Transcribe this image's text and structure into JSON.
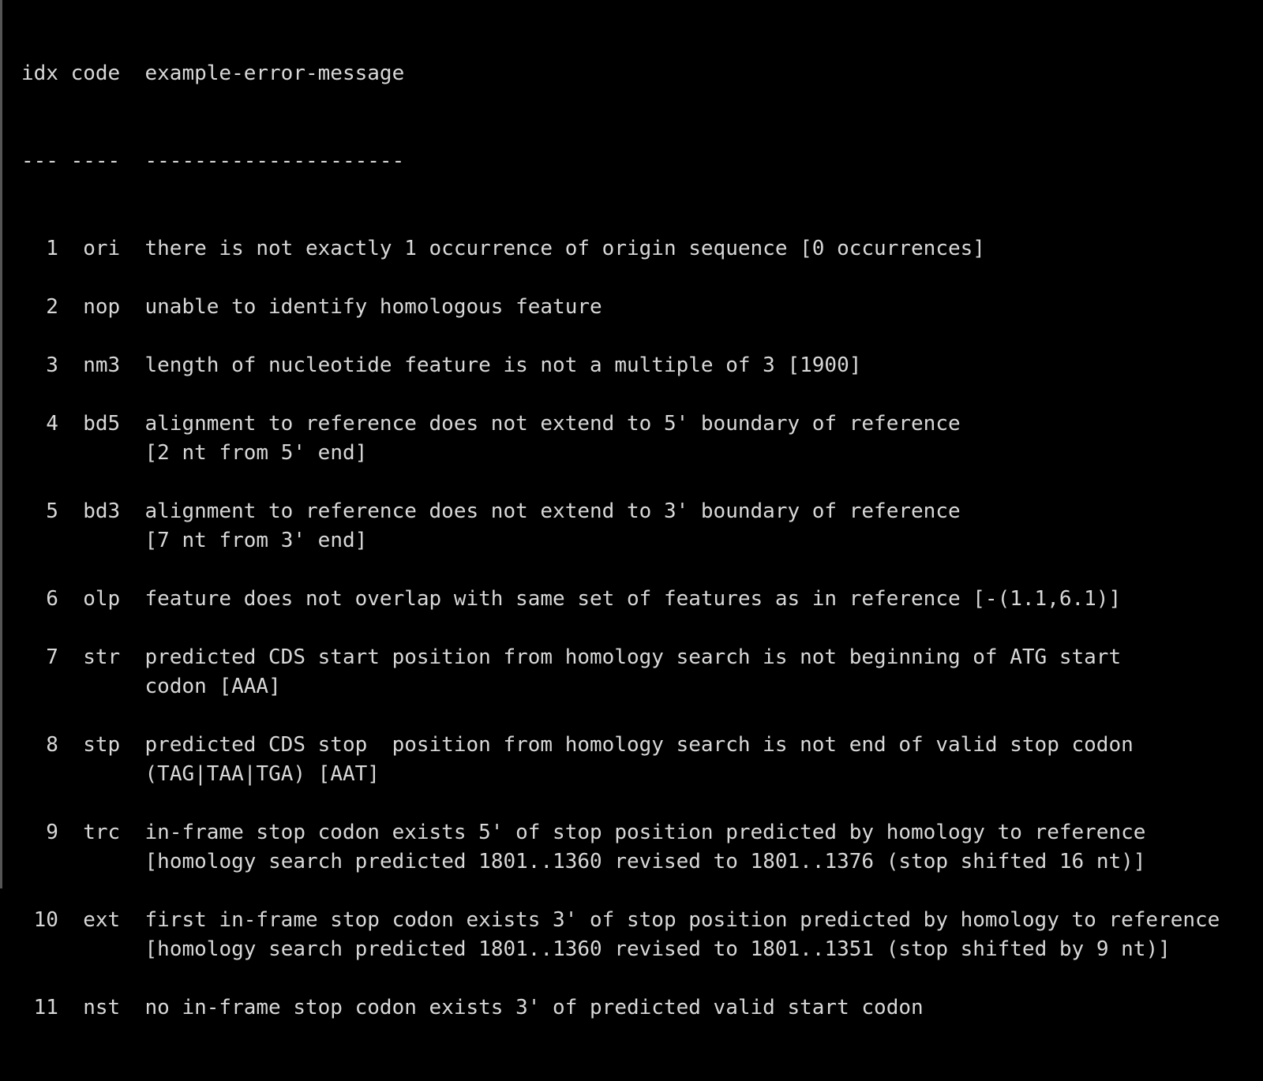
{
  "header": {
    "idx": "idx",
    "code": "code",
    "message": "example-error-message"
  },
  "separator": {
    "idx": "---",
    "code": "----",
    "message": "---------------------"
  },
  "rows": [
    {
      "idx": "1",
      "code": "ori",
      "lines": [
        "there is not exactly 1 occurrence of origin sequence [0 occurrences]"
      ]
    },
    {
      "idx": "2",
      "code": "nop",
      "lines": [
        "unable to identify homologous feature"
      ]
    },
    {
      "idx": "3",
      "code": "nm3",
      "lines": [
        "length of nucleotide feature is not a multiple of 3 [1900]"
      ]
    },
    {
      "idx": "4",
      "code": "bd5",
      "lines": [
        "alignment to reference does not extend to 5' boundary of reference",
        "[2 nt from 5' end]"
      ]
    },
    {
      "idx": "5",
      "code": "bd3",
      "lines": [
        "alignment to reference does not extend to 3' boundary of reference",
        "[7 nt from 3' end]"
      ]
    },
    {
      "idx": "6",
      "code": "olp",
      "lines": [
        "feature does not overlap with same set of features as in reference [-(1.1,6.1)]"
      ]
    },
    {
      "idx": "7",
      "code": "str",
      "lines": [
        "predicted CDS start position from homology search is not beginning of ATG start",
        "codon [AAA]"
      ]
    },
    {
      "idx": "8",
      "code": "stp",
      "lines": [
        "predicted CDS stop  position from homology search is not end of valid stop codon",
        "(TAG|TAA|TGA) [AAT]"
      ]
    },
    {
      "idx": "9",
      "code": "trc",
      "lines": [
        "in-frame stop codon exists 5' of stop position predicted by homology to reference",
        "[homology search predicted 1801..1360 revised to 1801..1376 (stop shifted 16 nt)]"
      ]
    },
    {
      "idx": "10",
      "code": "ext",
      "lines": [
        "first in-frame stop codon exists 3' of stop position predicted by homology to reference",
        "[homology search predicted 1801..1360 revised to 1801..1351 (stop shifted by 9 nt)]"
      ]
    },
    {
      "idx": "11",
      "code": "nst",
      "lines": [
        "no in-frame stop codon exists 3' of predicted valid start codon"
      ]
    }
  ]
}
